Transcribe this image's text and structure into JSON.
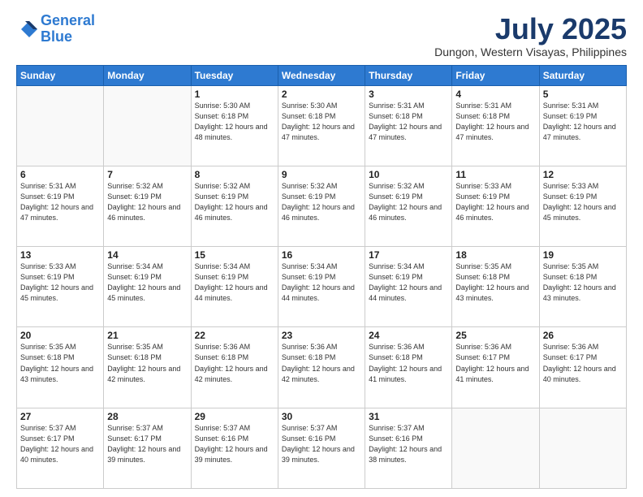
{
  "header": {
    "logo_line1": "General",
    "logo_line2": "Blue",
    "month_title": "July 2025",
    "location": "Dungon, Western Visayas, Philippines"
  },
  "days_of_week": [
    "Sunday",
    "Monday",
    "Tuesday",
    "Wednesday",
    "Thursday",
    "Friday",
    "Saturday"
  ],
  "weeks": [
    [
      {
        "day": "",
        "sunrise": "",
        "sunset": "",
        "daylight": ""
      },
      {
        "day": "",
        "sunrise": "",
        "sunset": "",
        "daylight": ""
      },
      {
        "day": "1",
        "sunrise": "Sunrise: 5:30 AM",
        "sunset": "Sunset: 6:18 PM",
        "daylight": "Daylight: 12 hours and 48 minutes."
      },
      {
        "day": "2",
        "sunrise": "Sunrise: 5:30 AM",
        "sunset": "Sunset: 6:18 PM",
        "daylight": "Daylight: 12 hours and 47 minutes."
      },
      {
        "day": "3",
        "sunrise": "Sunrise: 5:31 AM",
        "sunset": "Sunset: 6:18 PM",
        "daylight": "Daylight: 12 hours and 47 minutes."
      },
      {
        "day": "4",
        "sunrise": "Sunrise: 5:31 AM",
        "sunset": "Sunset: 6:18 PM",
        "daylight": "Daylight: 12 hours and 47 minutes."
      },
      {
        "day": "5",
        "sunrise": "Sunrise: 5:31 AM",
        "sunset": "Sunset: 6:19 PM",
        "daylight": "Daylight: 12 hours and 47 minutes."
      }
    ],
    [
      {
        "day": "6",
        "sunrise": "Sunrise: 5:31 AM",
        "sunset": "Sunset: 6:19 PM",
        "daylight": "Daylight: 12 hours and 47 minutes."
      },
      {
        "day": "7",
        "sunrise": "Sunrise: 5:32 AM",
        "sunset": "Sunset: 6:19 PM",
        "daylight": "Daylight: 12 hours and 46 minutes."
      },
      {
        "day": "8",
        "sunrise": "Sunrise: 5:32 AM",
        "sunset": "Sunset: 6:19 PM",
        "daylight": "Daylight: 12 hours and 46 minutes."
      },
      {
        "day": "9",
        "sunrise": "Sunrise: 5:32 AM",
        "sunset": "Sunset: 6:19 PM",
        "daylight": "Daylight: 12 hours and 46 minutes."
      },
      {
        "day": "10",
        "sunrise": "Sunrise: 5:32 AM",
        "sunset": "Sunset: 6:19 PM",
        "daylight": "Daylight: 12 hours and 46 minutes."
      },
      {
        "day": "11",
        "sunrise": "Sunrise: 5:33 AM",
        "sunset": "Sunset: 6:19 PM",
        "daylight": "Daylight: 12 hours and 46 minutes."
      },
      {
        "day": "12",
        "sunrise": "Sunrise: 5:33 AM",
        "sunset": "Sunset: 6:19 PM",
        "daylight": "Daylight: 12 hours and 45 minutes."
      }
    ],
    [
      {
        "day": "13",
        "sunrise": "Sunrise: 5:33 AM",
        "sunset": "Sunset: 6:19 PM",
        "daylight": "Daylight: 12 hours and 45 minutes."
      },
      {
        "day": "14",
        "sunrise": "Sunrise: 5:34 AM",
        "sunset": "Sunset: 6:19 PM",
        "daylight": "Daylight: 12 hours and 45 minutes."
      },
      {
        "day": "15",
        "sunrise": "Sunrise: 5:34 AM",
        "sunset": "Sunset: 6:19 PM",
        "daylight": "Daylight: 12 hours and 44 minutes."
      },
      {
        "day": "16",
        "sunrise": "Sunrise: 5:34 AM",
        "sunset": "Sunset: 6:19 PM",
        "daylight": "Daylight: 12 hours and 44 minutes."
      },
      {
        "day": "17",
        "sunrise": "Sunrise: 5:34 AM",
        "sunset": "Sunset: 6:19 PM",
        "daylight": "Daylight: 12 hours and 44 minutes."
      },
      {
        "day": "18",
        "sunrise": "Sunrise: 5:35 AM",
        "sunset": "Sunset: 6:18 PM",
        "daylight": "Daylight: 12 hours and 43 minutes."
      },
      {
        "day": "19",
        "sunrise": "Sunrise: 5:35 AM",
        "sunset": "Sunset: 6:18 PM",
        "daylight": "Daylight: 12 hours and 43 minutes."
      }
    ],
    [
      {
        "day": "20",
        "sunrise": "Sunrise: 5:35 AM",
        "sunset": "Sunset: 6:18 PM",
        "daylight": "Daylight: 12 hours and 43 minutes."
      },
      {
        "day": "21",
        "sunrise": "Sunrise: 5:35 AM",
        "sunset": "Sunset: 6:18 PM",
        "daylight": "Daylight: 12 hours and 42 minutes."
      },
      {
        "day": "22",
        "sunrise": "Sunrise: 5:36 AM",
        "sunset": "Sunset: 6:18 PM",
        "daylight": "Daylight: 12 hours and 42 minutes."
      },
      {
        "day": "23",
        "sunrise": "Sunrise: 5:36 AM",
        "sunset": "Sunset: 6:18 PM",
        "daylight": "Daylight: 12 hours and 42 minutes."
      },
      {
        "day": "24",
        "sunrise": "Sunrise: 5:36 AM",
        "sunset": "Sunset: 6:18 PM",
        "daylight": "Daylight: 12 hours and 41 minutes."
      },
      {
        "day": "25",
        "sunrise": "Sunrise: 5:36 AM",
        "sunset": "Sunset: 6:17 PM",
        "daylight": "Daylight: 12 hours and 41 minutes."
      },
      {
        "day": "26",
        "sunrise": "Sunrise: 5:36 AM",
        "sunset": "Sunset: 6:17 PM",
        "daylight": "Daylight: 12 hours and 40 minutes."
      }
    ],
    [
      {
        "day": "27",
        "sunrise": "Sunrise: 5:37 AM",
        "sunset": "Sunset: 6:17 PM",
        "daylight": "Daylight: 12 hours and 40 minutes."
      },
      {
        "day": "28",
        "sunrise": "Sunrise: 5:37 AM",
        "sunset": "Sunset: 6:17 PM",
        "daylight": "Daylight: 12 hours and 39 minutes."
      },
      {
        "day": "29",
        "sunrise": "Sunrise: 5:37 AM",
        "sunset": "Sunset: 6:16 PM",
        "daylight": "Daylight: 12 hours and 39 minutes."
      },
      {
        "day": "30",
        "sunrise": "Sunrise: 5:37 AM",
        "sunset": "Sunset: 6:16 PM",
        "daylight": "Daylight: 12 hours and 39 minutes."
      },
      {
        "day": "31",
        "sunrise": "Sunrise: 5:37 AM",
        "sunset": "Sunset: 6:16 PM",
        "daylight": "Daylight: 12 hours and 38 minutes."
      },
      {
        "day": "",
        "sunrise": "",
        "sunset": "",
        "daylight": ""
      },
      {
        "day": "",
        "sunrise": "",
        "sunset": "",
        "daylight": ""
      }
    ]
  ]
}
